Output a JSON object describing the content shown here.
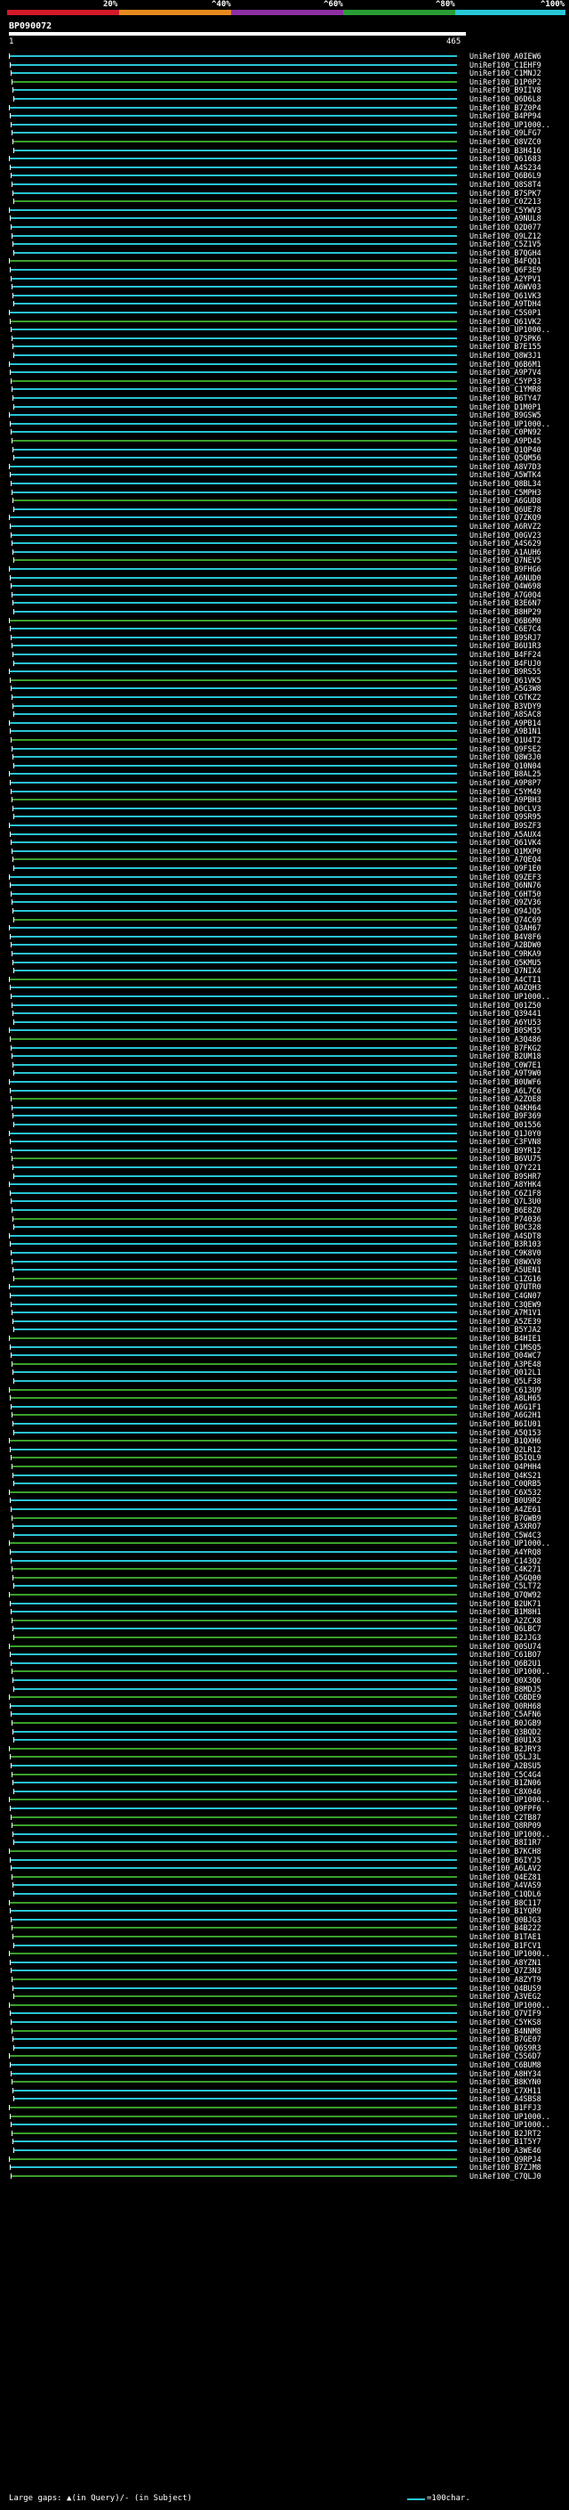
{
  "scale": {
    "labels": [
      "20%",
      "^40%",
      "^60%",
      "^80%",
      "^100%"
    ],
    "colors": [
      "#d41a2a",
      "#e58a1e",
      "#8d2fa3",
      "#2a9c36",
      "#28c8d8"
    ]
  },
  "query": {
    "id": "BP090072",
    "start": "1",
    "end": "465"
  },
  "legend": {
    "gaps": "Large gaps: ▲(in Query)/- (in Subject)",
    "key": "=100char."
  },
  "colors": {
    "cyan": "#29c4d6",
    "green": "#3aa02c",
    "white": "#ffffff"
  },
  "hits": [
    "UniRef100_A0IEW6",
    "UniRef100_C1EHF9",
    "UniRef100_C1MNJ2",
    "UniRef100_D1P0P2",
    "UniRef100_B9IIV8",
    "UniRef100_Q6D6L8",
    "UniRef100_B7Z0P4",
    "UniRef100_B4PP94",
    "UniRef100_UP1000..",
    "UniRef100_Q9LFG7",
    "UniRef100_Q8VZC0",
    "UniRef100_B3H416",
    "UniRef100_Q61683",
    "UniRef100_A4S234",
    "UniRef100_Q6B6L9",
    "UniRef100_Q8S8T4",
    "UniRef100_B7SPK7",
    "UniRef100_C0Z213",
    "UniRef100_C5YWV3",
    "UniRef100_A9NUL8",
    "UniRef100_Q2D077",
    "UniRef100_Q9LZ12",
    "UniRef100_C5Z1V5",
    "UniRef100_B7QGH4",
    "UniRef100_B4FQQ1",
    "UniRef100_Q6F3E9",
    "UniRef100_A2YPV1",
    "UniRef100_A6WV03",
    "UniRef100_Q61VK3",
    "UniRef100_A9TDH4",
    "UniRef100_C5S0P1",
    "UniRef100_Q61VK2",
    "UniRef100_UP1000..",
    "UniRef100_Q7SPK6",
    "UniRef100_B7E155",
    "UniRef100_Q8W3J1",
    "UniRef100_Q6B6M1",
    "UniRef100_A9P7V4",
    "UniRef100_C5YP33",
    "UniRef100_C1YMR8",
    "UniRef100_B6TY47",
    "UniRef100_D1M0P1",
    "UniRef100_B9GSW5",
    "UniRef100_UP1000..",
    "UniRef100_C0PN92",
    "UniRef100_A9PD45",
    "UniRef100_Q1QP40",
    "UniRef100_Q5QM56",
    "UniRef100_A8V7D3",
    "UniRef100_A5WTK4",
    "UniRef100_Q8BL34",
    "UniRef100_C5MPH3",
    "UniRef100_A6GUD8",
    "UniRef100_Q6UE78",
    "UniRef100_Q7ZKQ9",
    "UniRef100_A6RVZ2",
    "UniRef100_Q0GV23",
    "UniRef100_A4S629",
    "UniRef100_A1AUH6",
    "UniRef100_Q7NEV5",
    "UniRef100_B9FHG6",
    "UniRef100_A6NUD0",
    "UniRef100_Q4W698",
    "UniRef100_A7G0Q4",
    "UniRef100_B3E6N7",
    "UniRef100_B8HP29",
    "UniRef100_Q6B6M0",
    "UniRef100_C6E7C4",
    "UniRef100_B9SRJ7",
    "UniRef100_B6U1R3",
    "UniRef100_B4FF24",
    "UniRef100_B4FUJ0",
    "UniRef100_B9RS55",
    "UniRef100_Q61VK5",
    "UniRef100_A5G3W8",
    "UniRef100_C6TKZ2",
    "UniRef100_B3VDY9",
    "UniRef100_A8SAC8",
    "UniRef100_A9PB14",
    "UniRef100_A9B1N1",
    "UniRef100_Q1U4T2",
    "UniRef100_Q9FSE2",
    "UniRef100_Q8W3J0",
    "UniRef100_Q10N04",
    "UniRef100_B8AL25",
    "UniRef100_A9P8P7",
    "UniRef100_C5YM49",
    "UniRef100_A9PBH3",
    "UniRef100_D0CLV3",
    "UniRef100_Q9SR95",
    "UniRef100_B9SZF3",
    "UniRef100_A5AUX4",
    "UniRef100_Q61VK4",
    "UniRef100_Q1MXP0",
    "UniRef100_A7QEQ4",
    "UniRef100_Q9F1E0",
    "UniRef100_Q9ZEF3",
    "UniRef100_Q6NN76",
    "UniRef100_C6HT50",
    "UniRef100_Q9ZV36",
    "UniRef100_Q94JQ5",
    "UniRef100_Q74C69",
    "UniRef100_Q3AH67",
    "UniRef100_B4V8F6",
    "UniRef100_A2BDW0",
    "UniRef100_C9RKA9",
    "UniRef100_Q5KMU5",
    "UniRef100_Q7NIX4",
    "UniRef100_A4CTI1",
    "UniRef100_A0ZQH3",
    "UniRef100_UP1000..",
    "UniRef100_Q01Z50",
    "UniRef100_Q39441",
    "UniRef100_A6YU53",
    "UniRef100_B0SM35",
    "UniRef100_A3Q486",
    "UniRef100_B7FKG2",
    "UniRef100_B2UM18",
    "UniRef100_C0W7E1",
    "UniRef100_A9T9W0",
    "UniRef100_B0UWF6",
    "UniRef100_A6L7C6",
    "UniRef100_A2ZOE8",
    "UniRef100_Q4KH64",
    "UniRef100_B9F369",
    "UniRef100_Q01556",
    "UniRef100_Q1J0Y0",
    "UniRef100_C3FVN8",
    "UniRef100_B9YR12",
    "UniRef100_B6VU75",
    "UniRef100_Q7Y221",
    "UniRef100_B9SHR7",
    "UniRef100_A8YHK4",
    "UniRef100_C6Z1F8",
    "UniRef100_Q7L3U0",
    "UniRef100_B6E8Z0",
    "UniRef100_P74036",
    "UniRef100_B0C328",
    "UniRef100_A4SDT8",
    "UniRef100_B3R103",
    "UniRef100_C9K8V0",
    "UniRef100_Q8WXV8",
    "UniRef100_A5UEN1",
    "UniRef100_C1ZG16",
    "UniRef100_Q7UTR0",
    "UniRef100_C4GN07",
    "UniRef100_C3QEW9",
    "UniRef100_A7M1V1",
    "UniRef100_A5ZE39",
    "UniRef100_B5YJA2",
    "UniRef100_B4HIE1",
    "UniRef100_C1MSQ5",
    "UniRef100_Q04WC7",
    "UniRef100_A3PE48",
    "UniRef100_Q012L1",
    "UniRef100_Q5LF38",
    "UniRef100_C613U9",
    "UniRef100_A8LH65",
    "UniRef100_A6G1F1",
    "UniRef100_A6G2H1",
    "UniRef100_B6IU01",
    "UniRef100_A5Q153",
    "UniRef100_B1QXH6",
    "UniRef100_Q2LR12",
    "UniRef100_B5IQL9",
    "UniRef100_Q4PHH4",
    "UniRef100_Q4KS21",
    "UniRef100_C0QRB5",
    "UniRef100_C6X532",
    "UniRef100_B0U9R2",
    "UniRef100_A4ZE61",
    "UniRef100_B7GWB9",
    "UniRef100_A3XRO7",
    "UniRef100_C5W4C3",
    "UniRef100_UP1000..",
    "UniRef100_A4YRQ8",
    "UniRef100_C143Q2",
    "UniRef100_C4K271",
    "UniRef100_A5GQ00",
    "UniRef100_C5LT72",
    "UniRef100_Q7QW92",
    "UniRef100_B2UK71",
    "UniRef100_B1M8H1",
    "UniRef100_A2ZCX8",
    "UniRef100_Q6LBC7",
    "UniRef100_B2JJG3",
    "UniRef100_Q0SU74",
    "UniRef100_C61BO7",
    "UniRef100_Q6B2U1",
    "UniRef100_UP1000..",
    "UniRef100_Q0X3Q6",
    "UniRef100_B8MDJ5",
    "UniRef100_C6BDE9",
    "UniRef100_Q0RH68",
    "UniRef100_C5AFN6",
    "UniRef100_B0JGB9",
    "UniRef100_Q3BQD2",
    "UniRef100_B0U1X3",
    "UniRef100_B2JRY3",
    "UniRef100_Q5LJ3L",
    "UniRef100_A2BSU5",
    "UniRef100_C5C4G4",
    "UniRef100_B1ZN06",
    "UniRef100_C8X046",
    "UniRef100_UP1000..",
    "UniRef100_Q9FPF6",
    "UniRef100_C2TB87",
    "UniRef100_Q8RP09",
    "UniRef100_UP1000..",
    "UniRef100_B8I1R7",
    "UniRef100_B7KCH8",
    "UniRef100_B6IYJ5",
    "UniRef100_A6LAV2",
    "UniRef100_Q4EZ81",
    "UniRef100_A4VAS9",
    "UniRef100_C1QDL6",
    "UniRef100_B8C117",
    "UniRef100_B1YQR9",
    "UniRef100_Q0BJG3",
    "UniRef100_B4B222",
    "UniRef100_B1TAE1",
    "UniRef100_B1FCV1",
    "UniRef100_UP1000..",
    "UniRef100_A8YZN1",
    "UniRef100_Q7Z3N3",
    "UniRef100_A8ZYT9",
    "UniRef100_Q4BUS9",
    "UniRef100_A3VEG2",
    "UniRef100_UP1000..",
    "UniRef100_Q7VIF9",
    "UniRef100_C5YKS8",
    "UniRef100_B4NNM8",
    "UniRef100_B7GE07",
    "UniRef100_Q6S9R3",
    "UniRef100_C5S6D7",
    "UniRef100_C6BUM8",
    "UniRef100_A8HY34",
    "UniRef100_B8KYN0",
    "UniRef100_C7XH11",
    "UniRef100_A4SBS8",
    "UniRef100_B1FFJ3",
    "UniRef100_UP1000..",
    "UniRef100_UP1000..",
    "UniRef100_B2JRT2",
    "UniRef100_B1T5Y7",
    "UniRef100_A3WE46",
    "UniRef100_Q9RPJ4",
    "UniRef100_B7ZJM8",
    "UniRef100_C7QLJ0"
  ]
}
